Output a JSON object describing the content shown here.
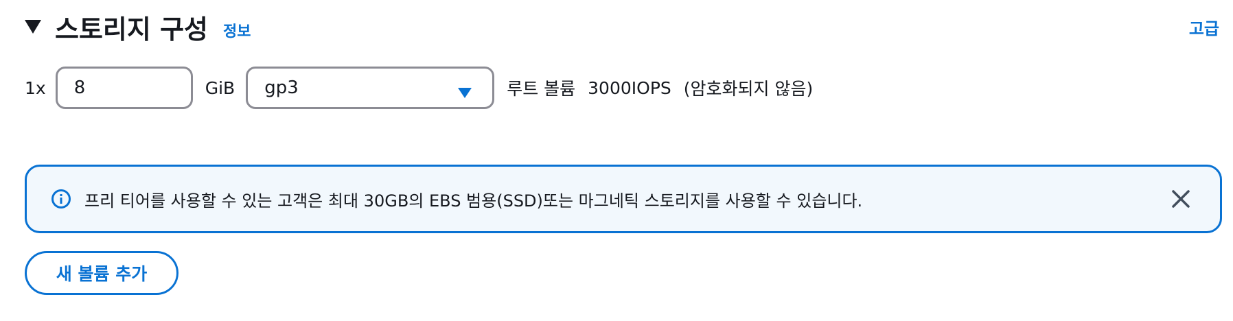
{
  "section": {
    "title": "스토리지 구성",
    "info_link": "정보",
    "advanced_link": "고급",
    "expanded": true
  },
  "volume": {
    "count_label": "1x",
    "size_value": "8",
    "unit_label": "GiB",
    "type_selected": "gp3",
    "root_label": "루트 볼륨",
    "iops_label": "3000IOPS",
    "encryption_label": "(암호화되지 않음)"
  },
  "alert": {
    "text": "프리 티어를 사용할 수 있는 고객은 최대 30GB의 EBS 범용(SSD)또는 마그네틱 스토리지를 사용할 수 있습니다.",
    "icon": "info-icon",
    "close_icon": "close-icon"
  },
  "actions": {
    "add_volume_label": "새 볼륨 추가"
  },
  "colors": {
    "accent": "#0972d3",
    "alert_background": "#f2f8fd",
    "input_border": "#8c8c94",
    "text": "#16191f"
  }
}
